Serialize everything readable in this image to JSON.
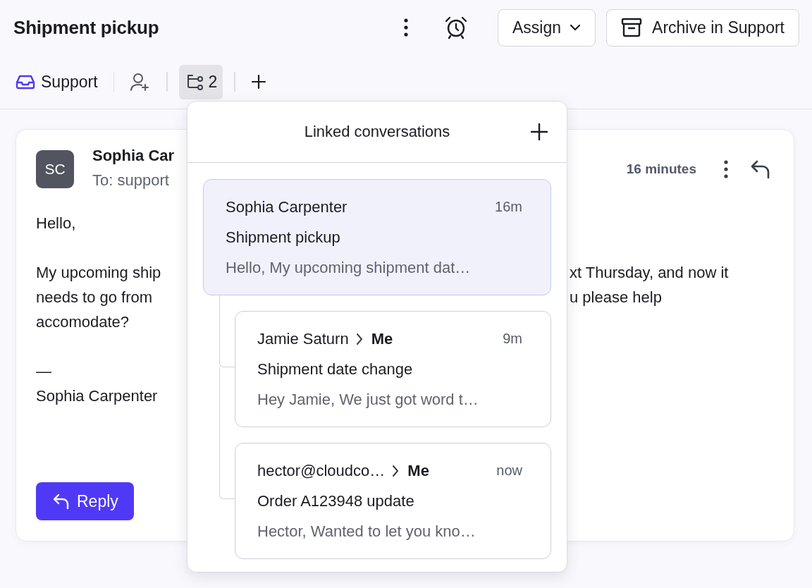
{
  "header": {
    "title": "Shipment pickup",
    "assign_label": "Assign",
    "archive_label": "Archive in Support"
  },
  "toolbar": {
    "inbox": "Support",
    "linked_count": "2",
    "linked_selected": true
  },
  "message": {
    "avatar": "SC",
    "sender": "Sophia Car",
    "to": "To: support",
    "time": "16 minutes",
    "paragraphs": [
      [
        {
          "left": "Hello,"
        }
      ],
      [
        {
          "left": "My upcoming ship",
          "right": "xt Thursday, and now it"
        },
        {
          "left": "needs to go from",
          "right": "u please help"
        },
        {
          "left": "accomodate?"
        }
      ],
      [
        {
          "left": "—"
        },
        {
          "left": "Sophia Carpenter"
        }
      ]
    ],
    "reply_label": "Reply"
  },
  "linked": {
    "title": "Linked conversations",
    "items": [
      {
        "from": "Sophia Carpenter",
        "time": "16m",
        "subject": "Shipment pickup",
        "preview": "Hello, My upcoming shipment dat…",
        "selected": true,
        "children": [
          {
            "from": "Jamie Saturn",
            "to": "Me",
            "time": "9m",
            "subject": "Shipment date change",
            "preview": "Hey Jamie, We just got word t…",
            "selected": false
          },
          {
            "from": "hector@cloudco…",
            "to": "Me",
            "time": "now",
            "subject": "Order A123948 update",
            "preview": "Hector, Wanted to let you kno…",
            "selected": false
          }
        ]
      }
    ]
  }
}
